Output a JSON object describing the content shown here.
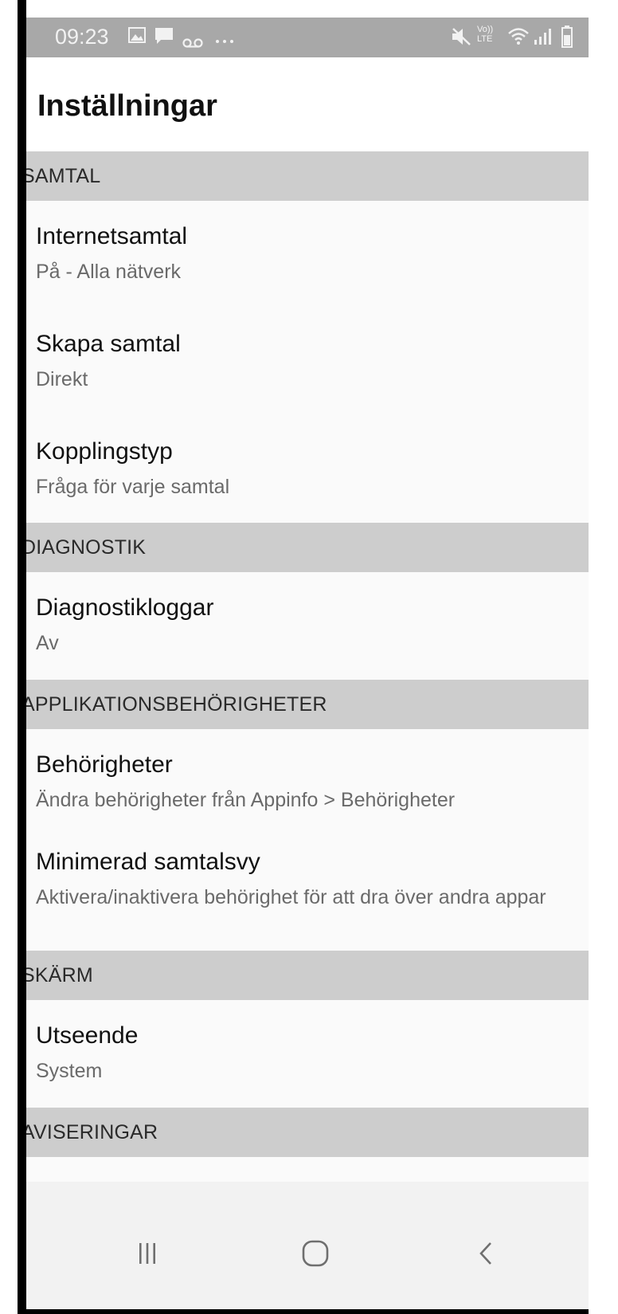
{
  "status_bar": {
    "time": "09:23",
    "icons_left": [
      "gallery-icon",
      "message-icon",
      "voicemail-icon",
      "more-dots-icon"
    ],
    "icons_right": [
      "mute-icon",
      "volte-icon",
      "wifi-icon",
      "signal-icon",
      "battery-icon"
    ],
    "volte_text_top": "Vo))",
    "volte_text_bottom": "LTE"
  },
  "header": {
    "title": "Inställningar"
  },
  "sections": [
    {
      "title": "SAMTAL",
      "items": [
        {
          "label": "Internetsamtal",
          "value": "På - Alla nätverk"
        },
        {
          "label": "Skapa samtal",
          "value": "Direkt"
        },
        {
          "label": "Kopplingstyp",
          "value": "Fråga för varje samtal"
        }
      ]
    },
    {
      "title": "DIAGNOSTIK",
      "items": [
        {
          "label": "Diagnostikloggar",
          "value": "Av"
        }
      ]
    },
    {
      "title": "APPLIKATIONSBEHÖRIGHETER",
      "items": [
        {
          "label": "Behörigheter",
          "value": "Ändra behörigheter från Appinfo > Behörigheter"
        },
        {
          "label": "Minimerad samtalsvy",
          "value": "Aktivera/inaktivera behörighet för att dra över andra appar"
        }
      ]
    },
    {
      "title": "SKÄRM",
      "items": [
        {
          "label": "Utseende",
          "value": "System"
        }
      ]
    },
    {
      "title": "AVISERINGAR",
      "items": []
    }
  ],
  "nav_bar": {
    "buttons": [
      "recent-apps-icon",
      "home-icon",
      "back-icon"
    ]
  },
  "colors": {
    "status_bar_bg": "#a8a8a8",
    "section_bg": "#cdcdcd",
    "nav_bar_bg": "#f2f2f2"
  }
}
